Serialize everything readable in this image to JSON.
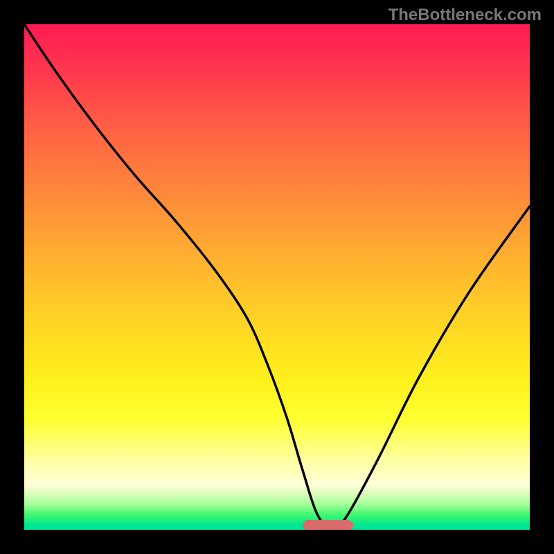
{
  "watermark": "TheBottleneck.com",
  "colors": {
    "background": "#000000",
    "curve": "#000000",
    "sweet_spot": "#d86b6b"
  },
  "chart_data": {
    "type": "line",
    "title": "",
    "xlabel": "",
    "ylabel": "",
    "xlim": [
      0,
      100
    ],
    "ylim": [
      0,
      100
    ],
    "series": [
      {
        "name": "bottleneck-curve",
        "x": [
          0,
          6,
          14,
          22,
          30,
          38,
          44,
          48,
          52,
          55,
          58,
          61,
          64,
          70,
          78,
          88,
          100
        ],
        "values": [
          100,
          91,
          80,
          70,
          61,
          51,
          42,
          33,
          22,
          12,
          3,
          0,
          3,
          14,
          30,
          47,
          64
        ]
      }
    ],
    "sweet_spot": {
      "x_start": 55,
      "x_end": 65,
      "y": 0
    },
    "grid": false,
    "legend": false
  }
}
